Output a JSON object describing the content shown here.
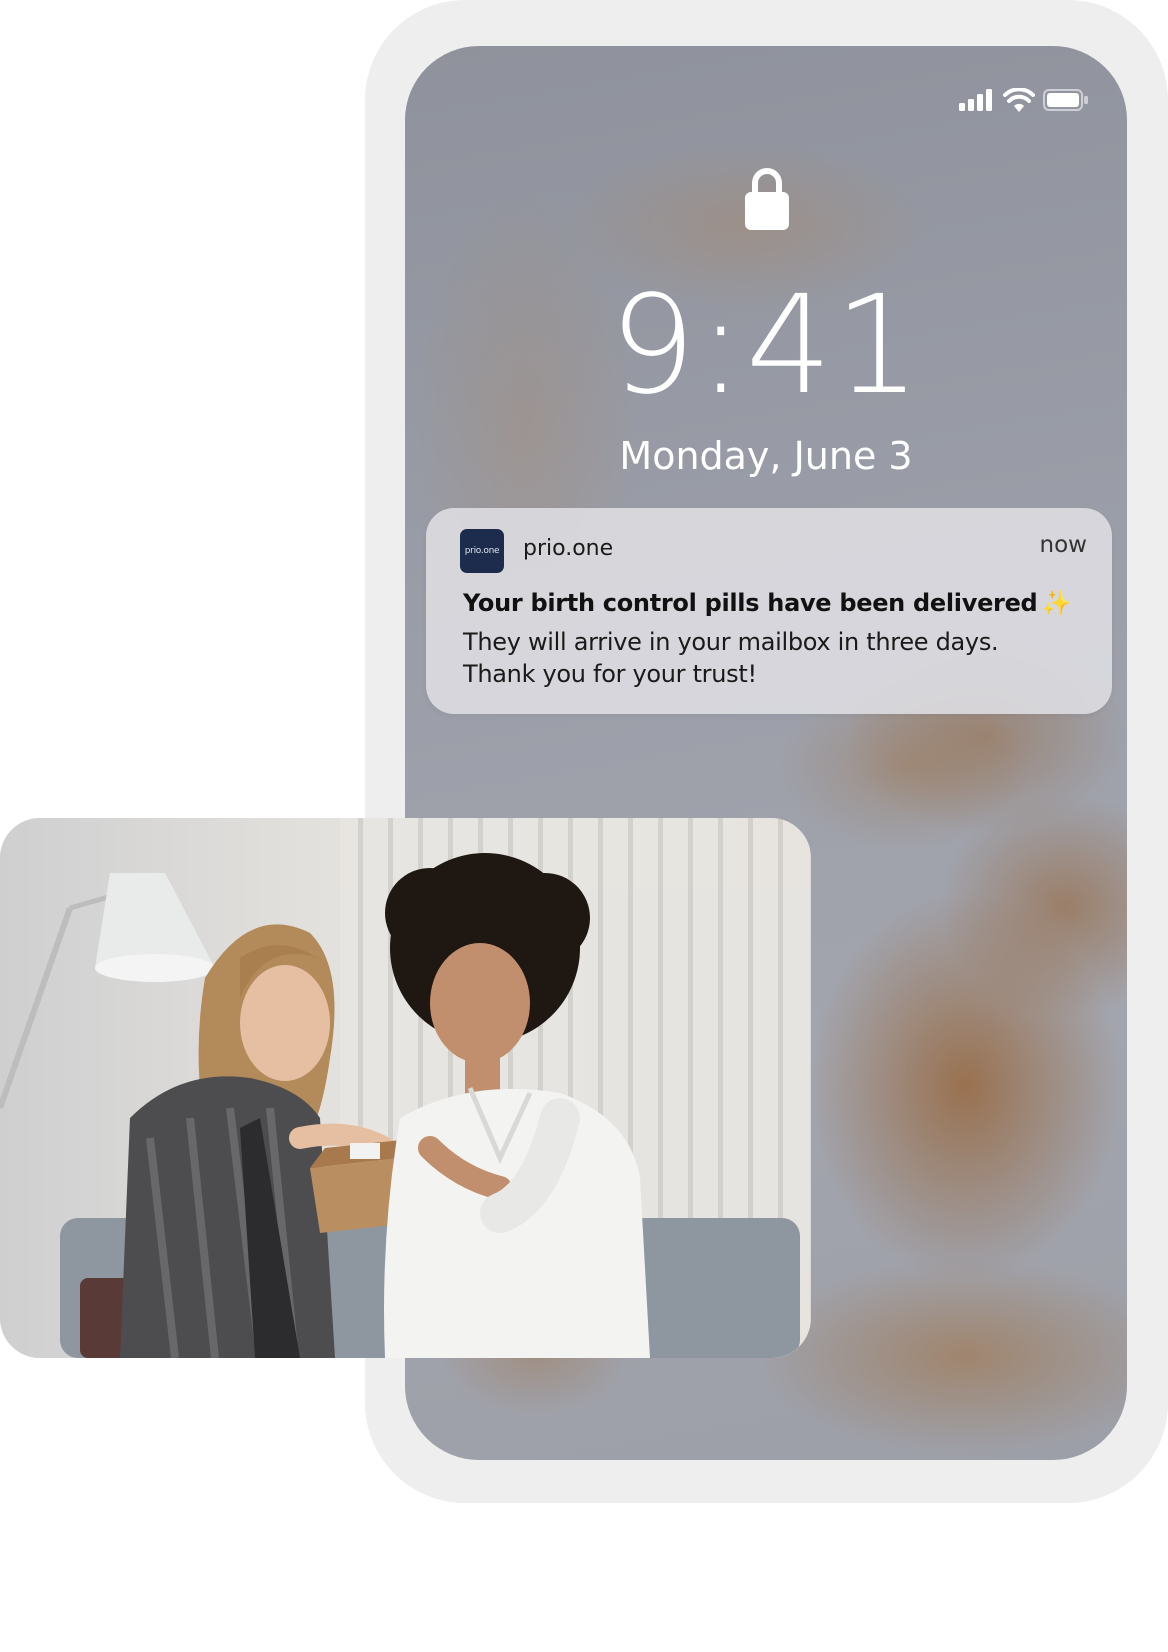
{
  "status_bar": {
    "icons": [
      "signal-icon",
      "wifi-icon",
      "battery-icon"
    ]
  },
  "lock_screen": {
    "time": "9:41",
    "date": "Monday, June 3",
    "lock_icon": "lock-icon"
  },
  "notification": {
    "app_icon_text": "prio.one",
    "app_name": "prio.one",
    "timestamp": "now",
    "title": "Your birth control pills have been delivered",
    "title_emoji": "✨",
    "body_line_1": "They will arrive in your mailbox in three days.",
    "body_line_2": "Thank you for your trust!"
  },
  "photo": {
    "subject_icon": "photo-two-women-opening-package"
  },
  "colors": {
    "phone_frame": "#eeeeee",
    "notification_bg": "#dedee2",
    "app_icon_bg": "#1d2b4c",
    "wallpaper_base": "#9b9ea8",
    "wallpaper_accent": "#96602f"
  }
}
